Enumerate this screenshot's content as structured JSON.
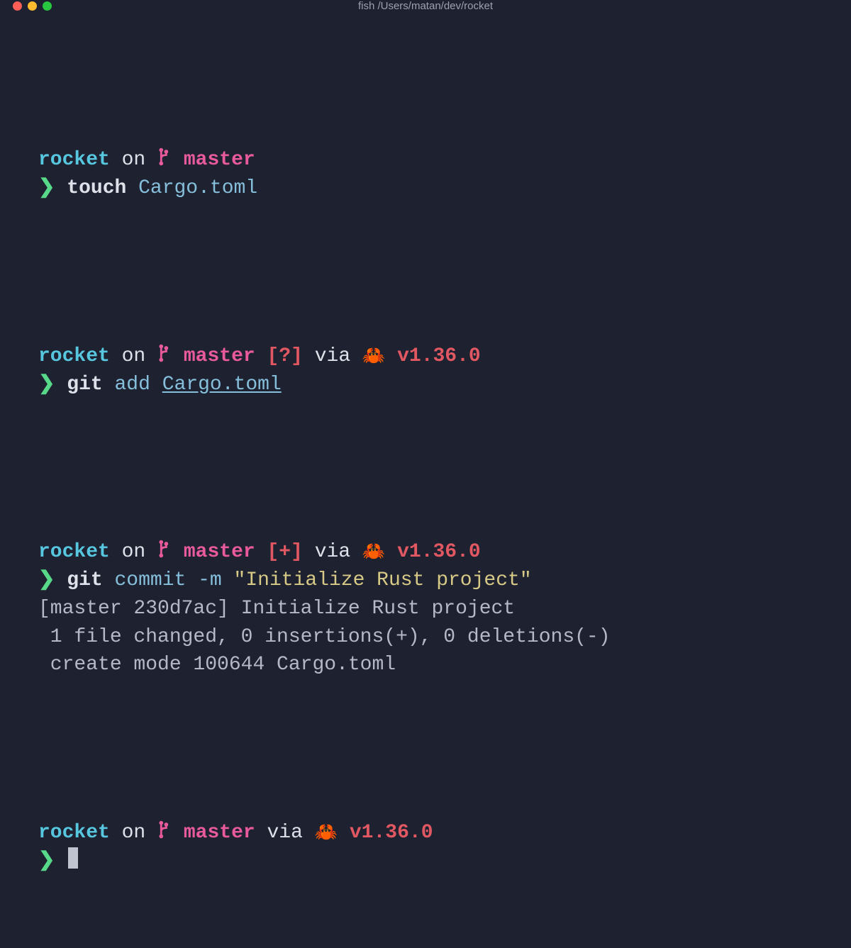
{
  "window": {
    "title": "fish /Users/matan/dev/rocket"
  },
  "prompt_common": {
    "dir": "rocket",
    "on": " on ",
    "branch": "master",
    "via": " via ",
    "rust_icon": "🦀",
    "rust_version": " v1.36.0",
    "arrow": "❯"
  },
  "blocks": {
    "b1": {
      "cmd": "touch",
      "arg": " Cargo.toml"
    },
    "b2": {
      "status": " [?]",
      "cmd": "git",
      "sub": " add ",
      "arg": "Cargo.toml"
    },
    "b3": {
      "status": " [+]",
      "cmd": "git",
      "sub": " commit ",
      "flag": "-m ",
      "msg": "\"Initialize Rust project\"",
      "out1": "[master 230d7ac] Initialize Rust project",
      "out2": " 1 file changed, 0 insertions(+), 0 deletions(-)",
      "out3": " create mode 100644 Cargo.toml"
    }
  }
}
